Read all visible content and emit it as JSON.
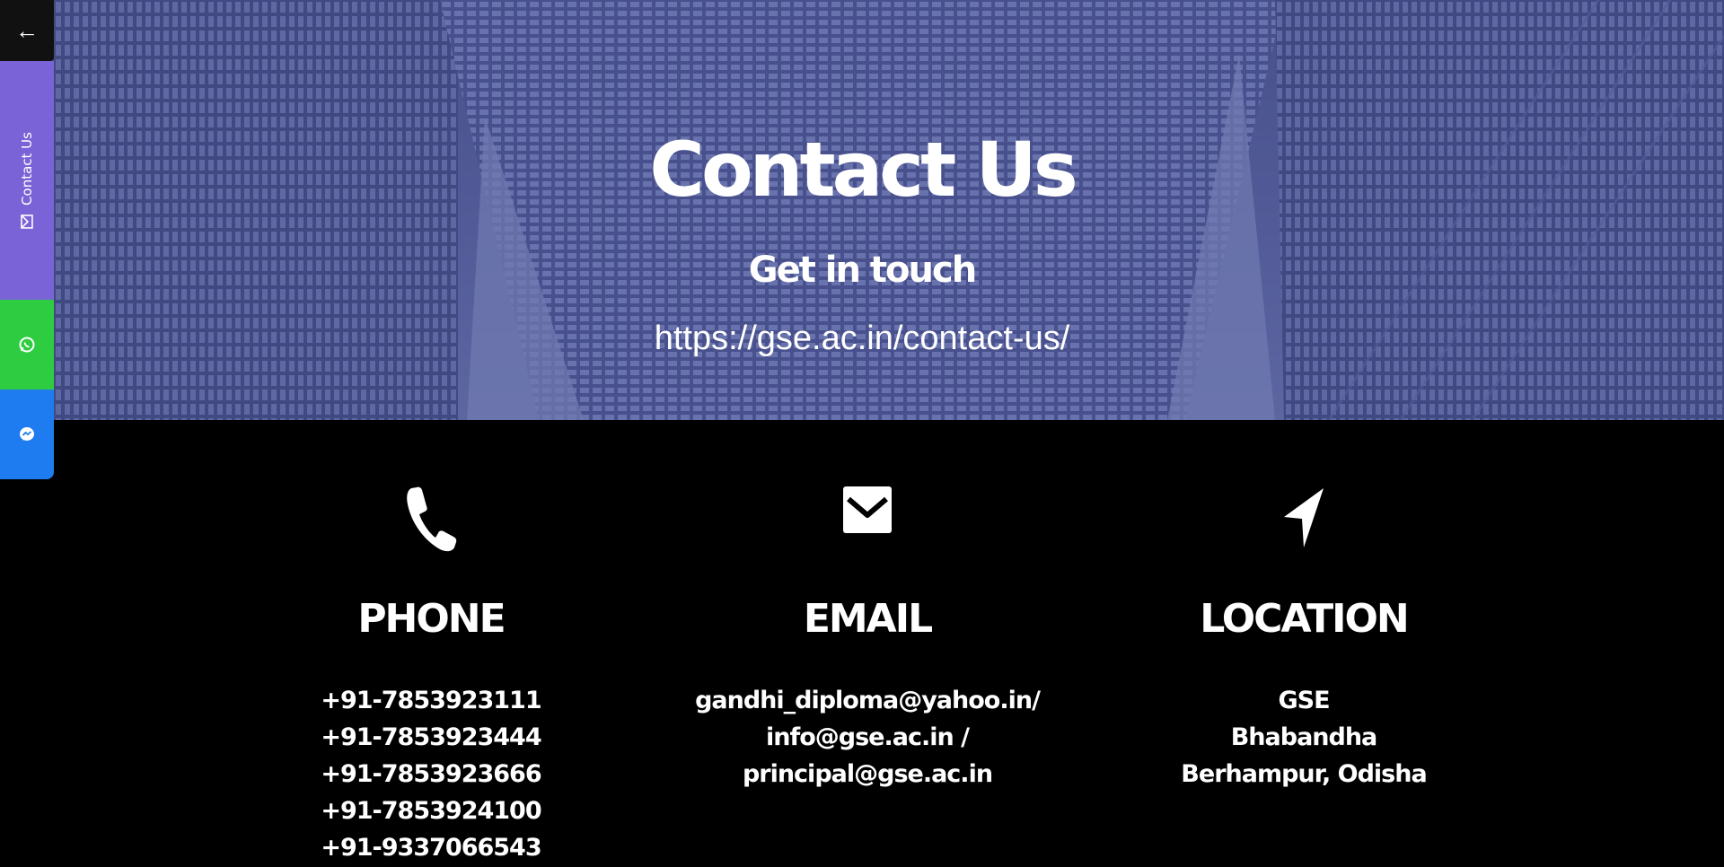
{
  "hero": {
    "title": "Contact Us",
    "subtitle": "Get in touch",
    "url": "https://gse.ac.in/contact-us/"
  },
  "side_bar": {
    "back_icon": "arrow-left-icon",
    "back_glyph": "←",
    "contact_label": "Contact Us",
    "contact_icon": "envelope-icon",
    "whatsapp_icon": "whatsapp-icon",
    "messenger_icon": "messenger-icon",
    "colors": {
      "back": "#111111",
      "contact": "#7a63d6",
      "whatsapp": "#2ecc40",
      "messenger": "#1e7cf0"
    }
  },
  "contact": {
    "phone": {
      "icon": "phone-icon",
      "heading": "PHONE",
      "lines": [
        "+91-7853923111",
        "+91-7853923444",
        "+91-7853923666",
        "+91-7853924100",
        "+91-9337066543"
      ]
    },
    "email": {
      "icon": "envelope-icon",
      "heading": "EMAIL",
      "lines": [
        "gandhi_diploma@yahoo.in/",
        "info@gse.ac.in / principal@gse.ac.in"
      ]
    },
    "location": {
      "icon": "location-arrow-icon",
      "heading": "LOCATION",
      "lines": [
        "GSE",
        "Bhabandha",
        "Berhampur, Odisha"
      ]
    }
  },
  "colors": {
    "hero_tint": "#5a6299",
    "section_bg": "#000000",
    "text": "#ffffff"
  }
}
